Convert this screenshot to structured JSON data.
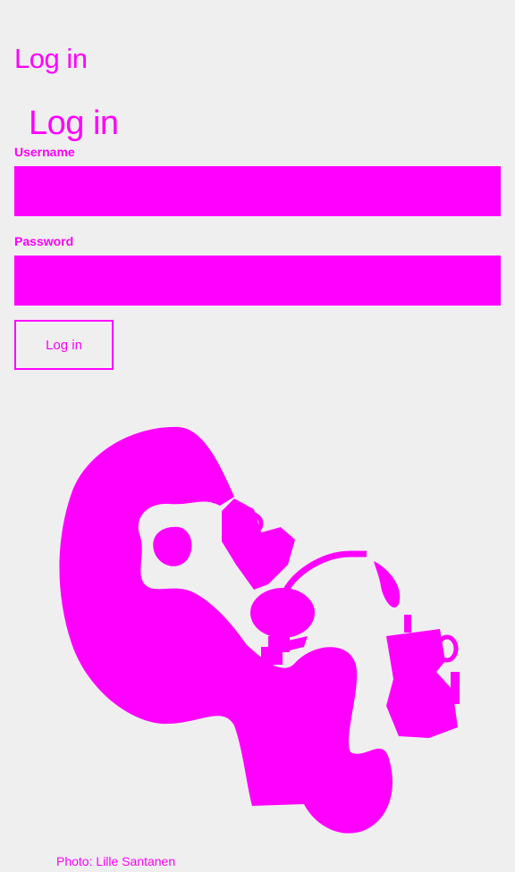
{
  "page": {
    "title": "Log in"
  },
  "login_form": {
    "heading": "Log in",
    "username_label": "Username",
    "username_value": "",
    "password_label": "Password",
    "password_value": "",
    "submit_label": "Log in"
  },
  "illustration": {
    "credit": "Photo: Lille Santanen"
  },
  "colors": {
    "accent": "#ff00ff",
    "background": "#efefef"
  }
}
